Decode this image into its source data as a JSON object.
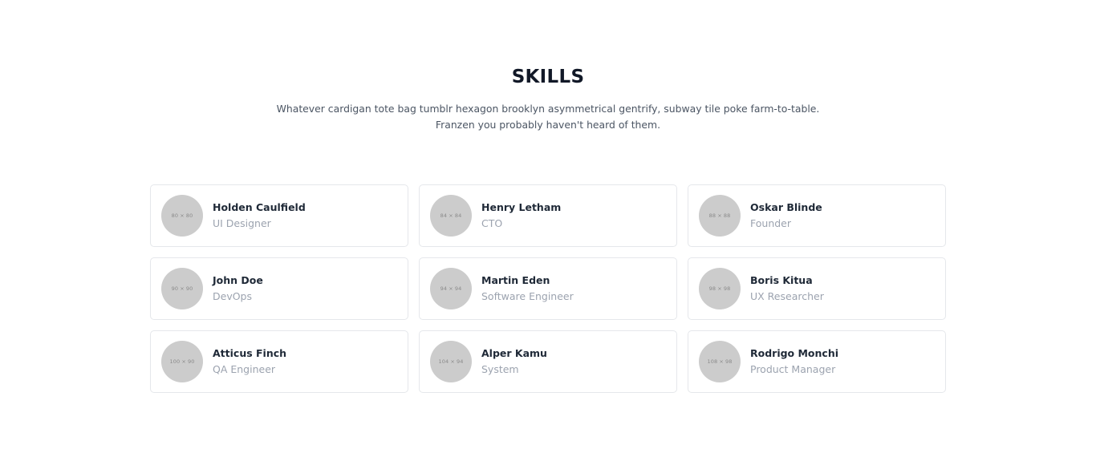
{
  "header": {
    "title": "SKILLS",
    "subtitle": "Whatever cardigan tote bag tumblr hexagon brooklyn asymmetrical gentrify, subway tile poke farm-to-table. Franzen you probably haven't heard of them."
  },
  "team": [
    {
      "avatar_label": "80 × 80",
      "name": "Holden Caulfield",
      "role": "UI Designer"
    },
    {
      "avatar_label": "84 × 84",
      "name": "Henry Letham",
      "role": "CTO"
    },
    {
      "avatar_label": "88 × 88",
      "name": "Oskar Blinde",
      "role": "Founder"
    },
    {
      "avatar_label": "90 × 90",
      "name": "John Doe",
      "role": "DevOps"
    },
    {
      "avatar_label": "94 × 94",
      "name": "Martin Eden",
      "role": "Software Engineer"
    },
    {
      "avatar_label": "98 × 98",
      "name": "Boris Kitua",
      "role": "UX Researcher"
    },
    {
      "avatar_label": "100 × 90",
      "name": "Atticus Finch",
      "role": "QA Engineer"
    },
    {
      "avatar_label": "104 × 94",
      "name": "Alper Kamu",
      "role": "System"
    },
    {
      "avatar_label": "108 × 98",
      "name": "Rodrigo Monchi",
      "role": "Product Manager"
    }
  ]
}
